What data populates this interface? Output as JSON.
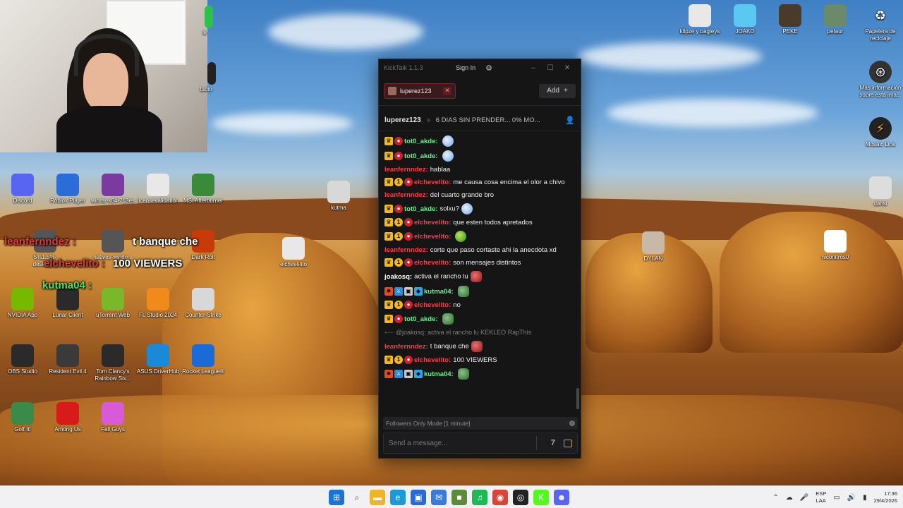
{
  "desktop": {
    "icons_left": [
      {
        "label": "Discord",
        "glyph": "discord-icon",
        "color": "#5865f2"
      },
      {
        "label": "Roblox Player",
        "glyph": "roblox-icon",
        "color": "#2a6dd8"
      },
      {
        "label": "winrar-x64-713es",
        "glyph": "winrar-icon",
        "color": "#7a3aa0"
      },
      {
        "label": "licensevalidation",
        "glyph": "file-icon",
        "color": "#e8e8e8"
      },
      {
        "label": "MSI Afterburner",
        "glyph": "afterburner-icon",
        "color": "#3a8a3a"
      },
      {
        "label": "5%1.5%-desktop...",
        "glyph": "app-icon",
        "color": "#555"
      },
      {
        "label": "natives-windo...",
        "glyph": "app-icon",
        "color": "#555"
      },
      {
        "label": "Dark Roll",
        "glyph": "game-icon",
        "color": "#c83a0a"
      },
      {
        "label": "NVIDIA App",
        "glyph": "nvidia-icon",
        "color": "#76b900"
      },
      {
        "label": "Lunar Client",
        "glyph": "lunar-icon",
        "color": "#2a2a2a"
      },
      {
        "label": "uTorrent Web",
        "glyph": "utorrent-icon",
        "color": "#78b82a"
      },
      {
        "label": "FL Studio 2024",
        "glyph": "flstudio-icon",
        "color": "#f08a1a"
      },
      {
        "label": "Counter-Strike",
        "glyph": "cs-icon",
        "color": "#d8d8d8"
      },
      {
        "label": "OBS Studio",
        "glyph": "obs-icon",
        "color": "#2a2a2a"
      },
      {
        "label": "Resident Evil 4",
        "glyph": "re4-icon",
        "color": "#3a3a3a"
      },
      {
        "label": "Tom Clancy's Rainbow Six...",
        "glyph": "r6-icon",
        "color": "#2a2a2a"
      },
      {
        "label": "ASUS DriverHub",
        "glyph": "asus-icon",
        "color": "#1a8ad8"
      },
      {
        "label": "Rocket League®",
        "glyph": "rocketleague-icon",
        "color": "#1a6ad8"
      },
      {
        "label": "Golf It!",
        "glyph": "golfit-icon",
        "color": "#3a8a4a"
      },
      {
        "label": "Among Us",
        "glyph": "amongus-icon",
        "color": "#d81a1a"
      },
      {
        "label": "Fall Guys",
        "glyph": "fallguys-icon",
        "color": "#d85ad8"
      }
    ],
    "icons_middle": [
      {
        "label": "kutma",
        "glyph": "folder-icon"
      },
      {
        "label": "elchevelito",
        "glyph": "folder-icon"
      },
      {
        "label": "DYLAN",
        "glyph": "folder-icon"
      }
    ],
    "icons_right": [
      {
        "label": "klipze y bagleys",
        "glyph": "folder-icon"
      },
      {
        "label": "JOAKO",
        "glyph": "folder-icon"
      },
      {
        "label": "PEKE",
        "glyph": "folder-icon"
      },
      {
        "label": "pefaur",
        "glyph": "folder-icon"
      },
      {
        "label": "Papelera de reciclaje",
        "glyph": "recycle-bin-icon"
      },
      {
        "label": "Más información sobre esta ima...",
        "glyph": "info-icon"
      },
      {
        "label": "Mosaic Link",
        "glyph": "mosaic-icon"
      },
      {
        "label": "dansi",
        "glyph": "folder-icon"
      },
      {
        "label": "niconitros0",
        "glyph": "folder-icon"
      }
    ],
    "top_partial": [
      "lk",
      "tudio"
    ],
    "overlay": {
      "line1_user": "leanfernndez :",
      "line1_text": "t banque che",
      "line2_user": "elchevelito :",
      "line2_text": "100 VIEWERS",
      "line3_user": "kutma04 :"
    }
  },
  "kicktalk": {
    "app_title": "KickTalk 1.1.3",
    "sign_in": "Sign In",
    "tab_name": "luperez123",
    "add_label": "Add",
    "add_icon": "+",
    "stream_channel": "luperez123",
    "stream_title": "6 DIAS SIN PRENDER... 0% MO...",
    "status_text": "Followers Only Mode [1 minute]",
    "input_placeholder": "Send a message...",
    "messages": [
      {
        "badges": [
          "crown",
          "sub"
        ],
        "user": "tot0_akde:",
        "ucolor": "u-green",
        "text": "",
        "emote": "e-blue"
      },
      {
        "badges": [
          "crown",
          "sub"
        ],
        "user": "tot0_akde:",
        "ucolor": "u-green",
        "text": "",
        "emote": "e-blue"
      },
      {
        "badges": [],
        "user": "leanfernndez:",
        "ucolor": "u-red",
        "text": "hablaa",
        "emote": ""
      },
      {
        "badges": [
          "crown",
          "one",
          "sub"
        ],
        "user": "elchevelito:",
        "ucolor": "u-red",
        "text": "me causa cosa encima el olor a chivo",
        "emote": ""
      },
      {
        "badges": [],
        "user": "leanfernndez:",
        "ucolor": "u-red",
        "text": "del cuarto grande bro",
        "emote": ""
      },
      {
        "badges": [
          "crown",
          "sub"
        ],
        "user": "tot0_akde:",
        "ucolor": "u-green",
        "text": "solxu?",
        "emote": "e-blue"
      },
      {
        "badges": [
          "crown",
          "one",
          "sub"
        ],
        "user": "elchevelito:",
        "ucolor": "u-red",
        "text": "que esten todos apretados",
        "emote": ""
      },
      {
        "badges": [
          "crown",
          "one",
          "sub"
        ],
        "user": "elchevelito:",
        "ucolor": "u-red",
        "text": "",
        "emote": "e-green"
      },
      {
        "badges": [],
        "user": "leanfernndez:",
        "ucolor": "u-red",
        "text": "corte que paso cortaste ahi la anecdota xd",
        "emote": ""
      },
      {
        "badges": [
          "crown",
          "one",
          "sub"
        ],
        "user": "elchevelito:",
        "ucolor": "u-red",
        "text": "son mensajes distintos",
        "emote": ""
      },
      {
        "badges": [],
        "user": "joakosq:",
        "ucolor": "u-white",
        "text": "activa el rancho lu",
        "emote": "e-red"
      },
      {
        "badges": [
          "fire",
          "blue",
          "grey",
          "cube"
        ],
        "user": "kutma04:",
        "ucolor": "u-green",
        "text": "",
        "emote": "e-pepe"
      },
      {
        "badges": [
          "crown",
          "one",
          "sub"
        ],
        "user": "elchevelito:",
        "ucolor": "u-red",
        "text": "no",
        "emote": ""
      },
      {
        "badges": [
          "crown",
          "sub"
        ],
        "user": "tot0_akde:",
        "ucolor": "u-green",
        "text": "",
        "emote": "e-pepe"
      },
      {
        "reply": "@joakosq: activa el rancho lu KEKLEO RapThis"
      },
      {
        "badges": [],
        "user": "leanfernndez:",
        "ucolor": "u-red",
        "text": "t banque che",
        "emote": "e-red"
      },
      {
        "badges": [
          "crown",
          "one",
          "sub"
        ],
        "user": "elchevelito:",
        "ucolor": "u-red",
        "text": "100 VIEWERS",
        "emote": ""
      },
      {
        "badges": [
          "fire",
          "blue",
          "grey",
          "cube"
        ],
        "user": "kutma04:",
        "ucolor": "u-green",
        "text": "",
        "emote": "e-pepe"
      }
    ]
  },
  "taskbar": {
    "apps": [
      {
        "name": "start-icon",
        "color": "#1a73d8"
      },
      {
        "name": "search-icon",
        "color": "#444"
      },
      {
        "name": "file-explorer-icon",
        "color": "#f0b428"
      },
      {
        "name": "edge-icon",
        "color": "#1a9ad8"
      },
      {
        "name": "store-icon",
        "color": "#2a6ad8"
      },
      {
        "name": "mail-icon",
        "color": "#3a7ad8"
      },
      {
        "name": "minecraft-icon",
        "color": "#5a8a3a"
      },
      {
        "name": "spotify-icon",
        "color": "#1db954"
      },
      {
        "name": "chrome-icon",
        "color": "#db4437"
      },
      {
        "name": "obs-icon",
        "color": "#222"
      },
      {
        "name": "kick-icon",
        "color": "#53fc18"
      },
      {
        "name": "discord-icon",
        "color": "#5865f2"
      }
    ],
    "lang_top": "ESP",
    "lang_bottom": "LAA",
    "time": "17:36",
    "date": "29/4/2026"
  }
}
